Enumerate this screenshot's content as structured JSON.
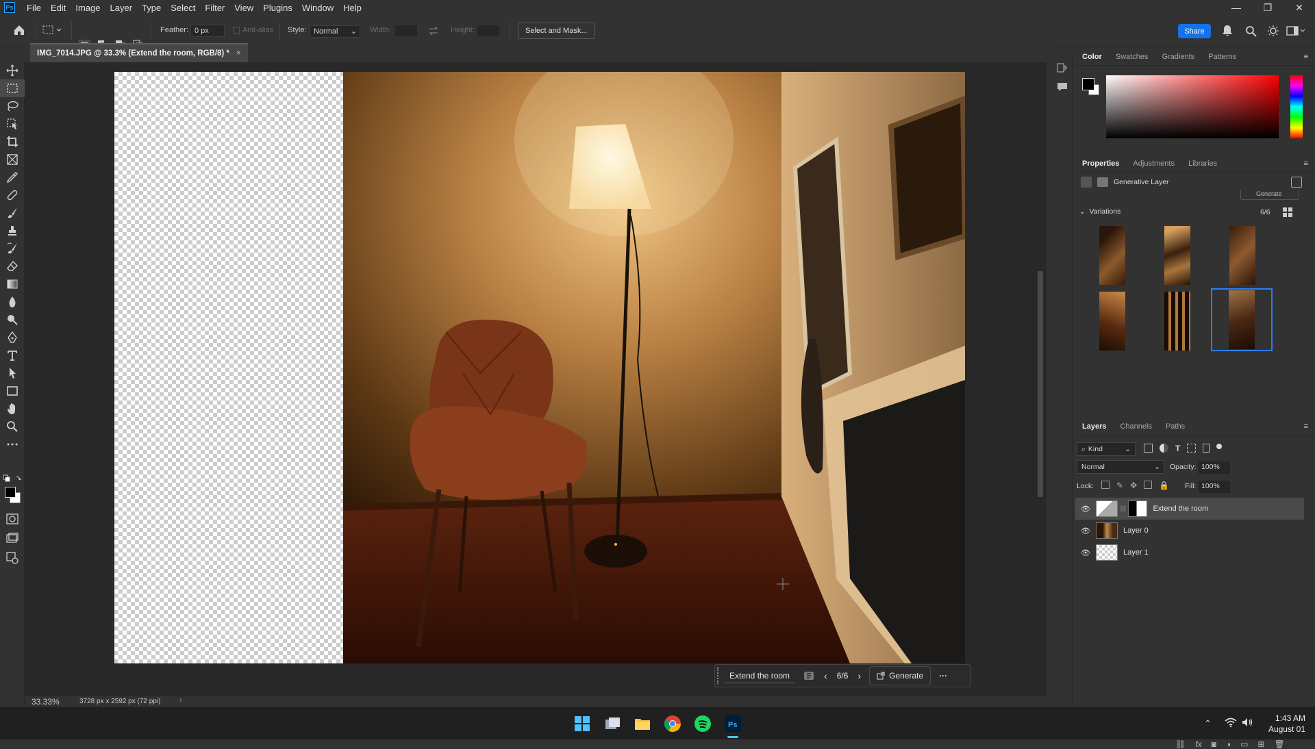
{
  "menubar": {
    "app_icon": "Ps",
    "items": [
      "File",
      "Edit",
      "Image",
      "Layer",
      "Type",
      "Select",
      "Filter",
      "View",
      "Plugins",
      "Window",
      "Help"
    ]
  },
  "optbar": {
    "feather_label": "Feather:",
    "feather_value": "0 px",
    "antialias_label": "Anti-alias",
    "style_label": "Style:",
    "style_value": "Normal",
    "width_label": "Width:",
    "height_label": "Height:",
    "select_mask_label": "Select and Mask...",
    "share_label": "Share"
  },
  "document": {
    "tab_title": "IMG_7014.JPG @ 33.3% (Extend the room, RGB/8) *",
    "close_glyph": "×"
  },
  "status": {
    "zoom": "33.33%",
    "dimensions": "3728 px x 2592 px (72 ppi)"
  },
  "context_bar": {
    "prompt": "Extend the room",
    "counter": "6/6",
    "generate_label": "Generate",
    "more_glyph": "···"
  },
  "color_panel": {
    "tabs": [
      "Color",
      "Swatches",
      "Gradients",
      "Patterns"
    ],
    "active_tab": "Color"
  },
  "properties_panel": {
    "tabs": [
      "Properties",
      "Adjustments",
      "Libraries"
    ],
    "active_tab": "Properties",
    "layer_type": "Generative Layer",
    "generate_label": "Generate",
    "variations_label": "Variations",
    "variations_count": "6/6"
  },
  "layers_panel": {
    "tabs": [
      "Layers",
      "Channels",
      "Paths"
    ],
    "active_tab": "Layers",
    "kind_label": "Kind",
    "blend_mode": "Normal",
    "opacity_label": "Opacity:",
    "opacity_value": "100%",
    "lock_label": "Lock:",
    "fill_label": "Fill:",
    "fill_value": "100%",
    "layers": [
      {
        "name": "Extend the room"
      },
      {
        "name": "Layer 0"
      },
      {
        "name": "Layer 1"
      }
    ]
  },
  "taskbar": {
    "time": "1:43 AM",
    "date": "August 01"
  },
  "colors": {
    "accent": "#1473e6",
    "selection_blue": "#2e7cf6"
  }
}
